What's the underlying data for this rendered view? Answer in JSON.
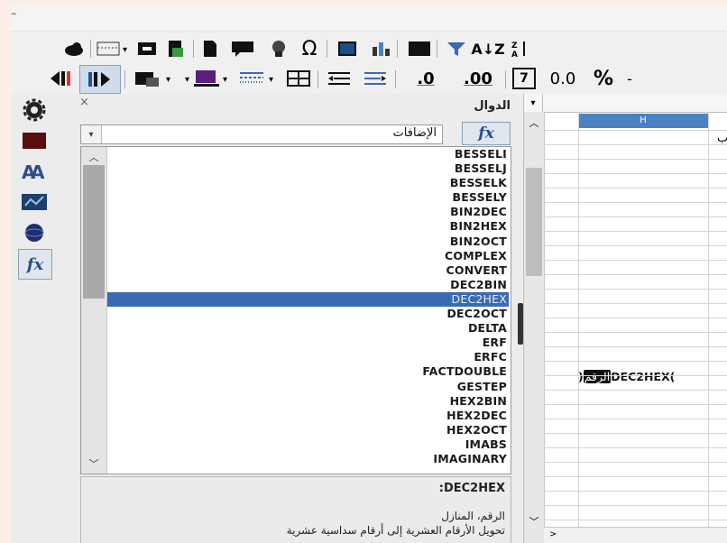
{
  "window": {
    "title_glyph": "⌢"
  },
  "toolbar": {
    "row1": [
      "cloud-icon",
      "header-footer-icon",
      "frame-icon",
      "export-pdf-icon",
      "page-icon",
      "comment-icon",
      "navigator-icon",
      "special-character-icon",
      "image-icon",
      "chart-icon",
      "pivot-table-icon",
      "autofilter-icon",
      "sort-ascending-icon",
      "sort-descending-icon"
    ],
    "row1_symbols": {
      "omega": "Ω",
      "sort_az": "A↓Z"
    },
    "row2": {
      "decimal_add": ".0",
      "decimal_remove": ".00",
      "number_format_box": "7",
      "number_format_decimal": "0.0",
      "percent": "%",
      "dash": "-"
    }
  },
  "sidebar": {
    "icons": [
      "properties-icon",
      "styles-icon",
      "gallery-icon",
      "navigator-icon",
      "functions-icon"
    ]
  },
  "functions_panel": {
    "title": "الدوال",
    "close": "×",
    "category": "الإضافات",
    "fx_label": "fx",
    "items": [
      "BESSELI",
      "BESSELJ",
      "BESSELK",
      "BESSELY",
      "BIN2DEC",
      "BIN2HEX",
      "BIN2OCT",
      "COMPLEX",
      "CONVERT",
      "DEC2BIN",
      "DEC2HEX",
      "DEC2OCT",
      "DELTA",
      "ERF",
      "ERFC",
      "FACTDOUBLE",
      "GESTEP",
      "HEX2BIN",
      "HEX2DEC",
      "HEX2OCT",
      "IMABS",
      "IMAGINARY"
    ],
    "selected_index": 10,
    "description": {
      "name": ":DEC2HEX",
      "params": "الرقم، المنازل",
      "text": "تحويل الأرقام العشرية إلى أرقام سداسية عشرية"
    }
  },
  "sheet": {
    "column_header": "H",
    "right_edge_char": "ب",
    "formula_cell": {
      "prefix": "DEC2HEX(",
      "highlight": "الرقم",
      "suffix": ")"
    },
    "bottom_char": ">"
  }
}
